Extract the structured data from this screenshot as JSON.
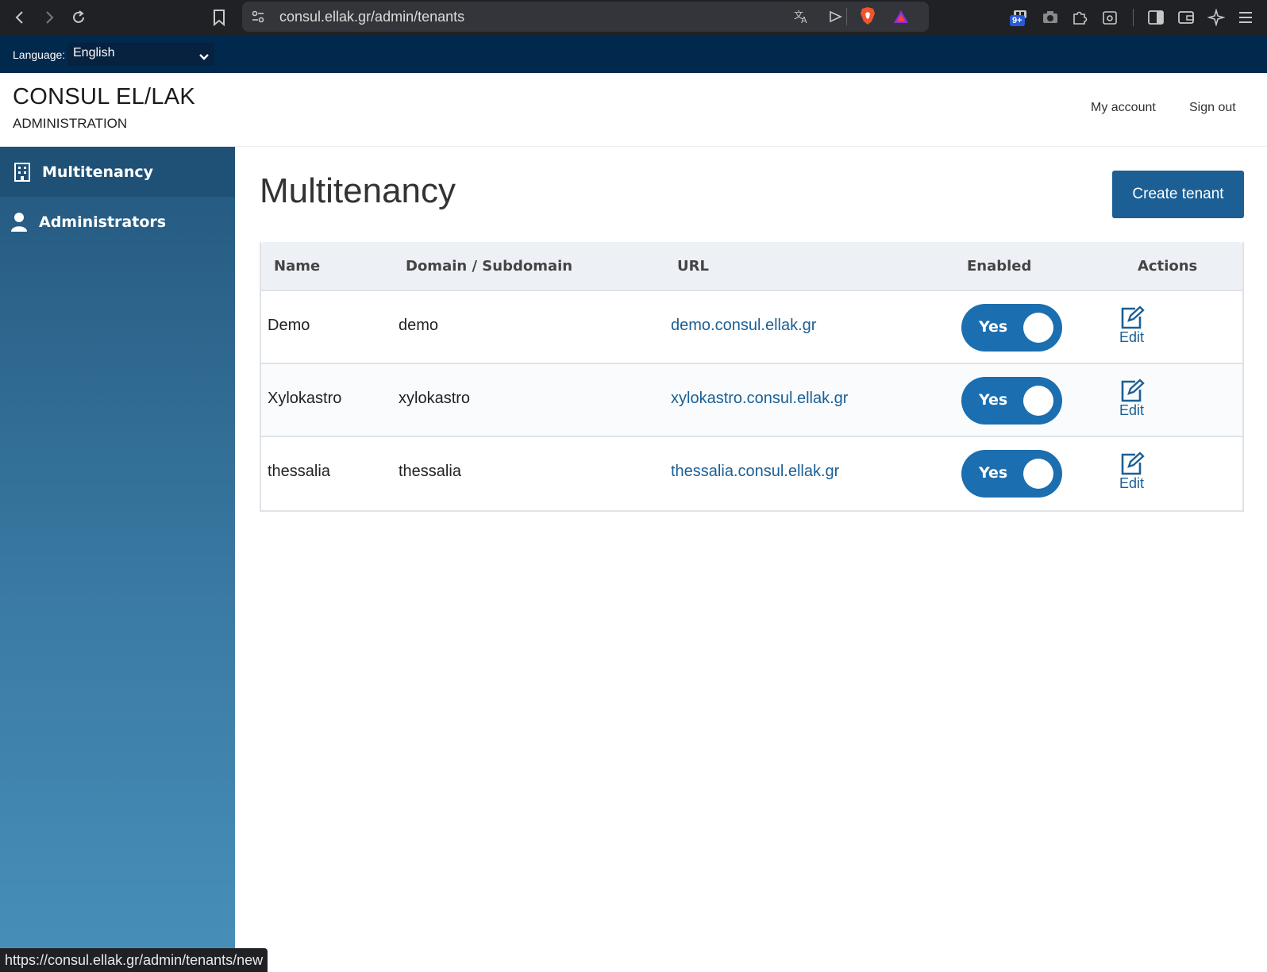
{
  "browser": {
    "url": "consul.ellak.gr/admin/tenants",
    "notification_badge": "9+",
    "icons": [
      "back-icon",
      "forward-icon",
      "reload-icon",
      "bookmark-icon",
      "site-settings-icon",
      "translate-icon",
      "send-icon",
      "brave-shield-icon",
      "brave-rewards-icon",
      "extensions-badge-icon",
      "camera-icon",
      "extensions-icon",
      "screenshot-icon",
      "sidebar-icon",
      "wallet-icon",
      "leo-ai-icon",
      "menu-icon"
    ]
  },
  "language_bar": {
    "label": "Language:",
    "selected": "English"
  },
  "header": {
    "brand": "CONSUL EL/LAK",
    "subtitle": "ADMINISTRATION",
    "my_account": "My account",
    "sign_out": "Sign out"
  },
  "sidebar": {
    "items": [
      {
        "label": "Multitenancy",
        "icon": "building-icon",
        "active": true
      },
      {
        "label": "Administrators",
        "icon": "user-icon",
        "active": false
      }
    ]
  },
  "main": {
    "title": "Multitenancy",
    "create_button": "Create tenant",
    "table": {
      "headers": [
        "Name",
        "Domain / Subdomain",
        "URL",
        "Enabled",
        "Actions"
      ],
      "rows": [
        {
          "name": "Demo",
          "domain": "demo",
          "url": "demo.consul.ellak.gr",
          "enabled": "Yes",
          "action": "Edit"
        },
        {
          "name": "Xylokastro",
          "domain": "xylokastro",
          "url": "xylokastro.consul.ellak.gr",
          "enabled": "Yes",
          "action": "Edit"
        },
        {
          "name": "thessalia",
          "domain": "thessalia",
          "url": "thessalia.consul.ellak.gr",
          "enabled": "Yes",
          "action": "Edit"
        }
      ]
    }
  },
  "status_bar": {
    "text": "https://consul.ellak.gr/admin/tenants/new"
  },
  "colors": {
    "primary": "#1b5f95",
    "toggle": "#1b6eaf",
    "top_bar": "#01294d",
    "sidebar_top": "#24587f",
    "sidebar_bottom": "#4790ba"
  }
}
